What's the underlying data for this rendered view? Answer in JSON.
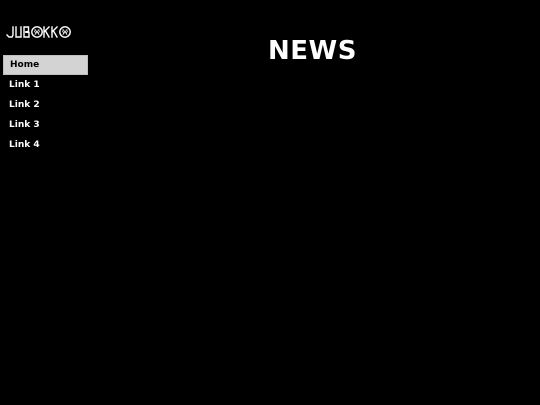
{
  "brand": {
    "logo_text": "JUBOKKO",
    "logo_icon": "skull-emblem-icon"
  },
  "sidebar": {
    "items": [
      {
        "label": "Home",
        "active": true
      },
      {
        "label": "Link 1",
        "active": false
      },
      {
        "label": "Link 2",
        "active": false
      },
      {
        "label": "Link 3",
        "active": false
      },
      {
        "label": "Link 4",
        "active": false
      }
    ]
  },
  "main": {
    "title": "NEWS"
  },
  "colors": {
    "background": "#000000",
    "text": "#ffffff",
    "active_item_bg": "#d3d3d3",
    "active_item_text": "#000000"
  }
}
